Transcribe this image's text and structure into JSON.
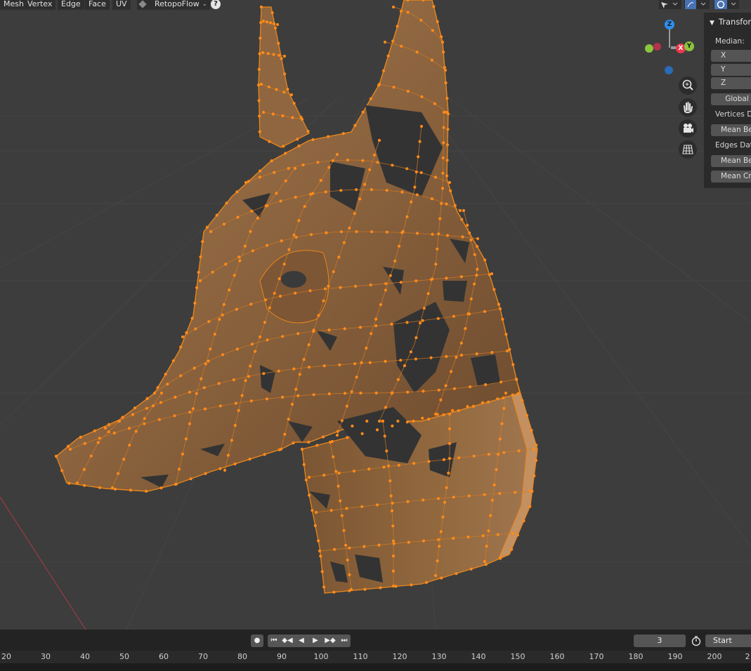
{
  "header": {
    "menus": [
      "Mesh",
      "Vertex",
      "Edge",
      "Face",
      "UV"
    ],
    "addon_label": "RetopoFlow",
    "help_label": "?"
  },
  "gizmo": {
    "axis_z": "Z",
    "axis_x": "X",
    "axis_y": "Y",
    "colors": {
      "x": "#e8394d",
      "y": "#8ac53d",
      "z": "#2c8ff0"
    }
  },
  "nav_buttons": [
    "zoom-icon",
    "pan-hand-icon",
    "camera-icon",
    "grid-toggle-icon"
  ],
  "npanel": {
    "title": "Transform",
    "median_label": "Median:",
    "x_label": "X",
    "y_label": "Y",
    "z_label": "Z",
    "global_label": "Global",
    "vertices_section": "Vertices Data",
    "vertices_mean": "Mean Bevel Weight",
    "edges_section": "Edges Data",
    "edges_mean_bevel": "Mean Bevel Weight",
    "edges_mean_crease": "Mean Crease"
  },
  "timeline": {
    "current_frame": "3",
    "start_label": "Start",
    "ruler_ticks": [
      "20",
      "30",
      "40",
      "50",
      "60",
      "70",
      "80",
      "90",
      "100",
      "110",
      "120",
      "130",
      "140",
      "150",
      "160",
      "170",
      "180",
      "190",
      "200",
      "2"
    ]
  },
  "colors": {
    "mesh_fill": "#8c6642",
    "wire": "#e8861b",
    "vertex": "#ff8a1a",
    "background": "#3d3d3d"
  }
}
